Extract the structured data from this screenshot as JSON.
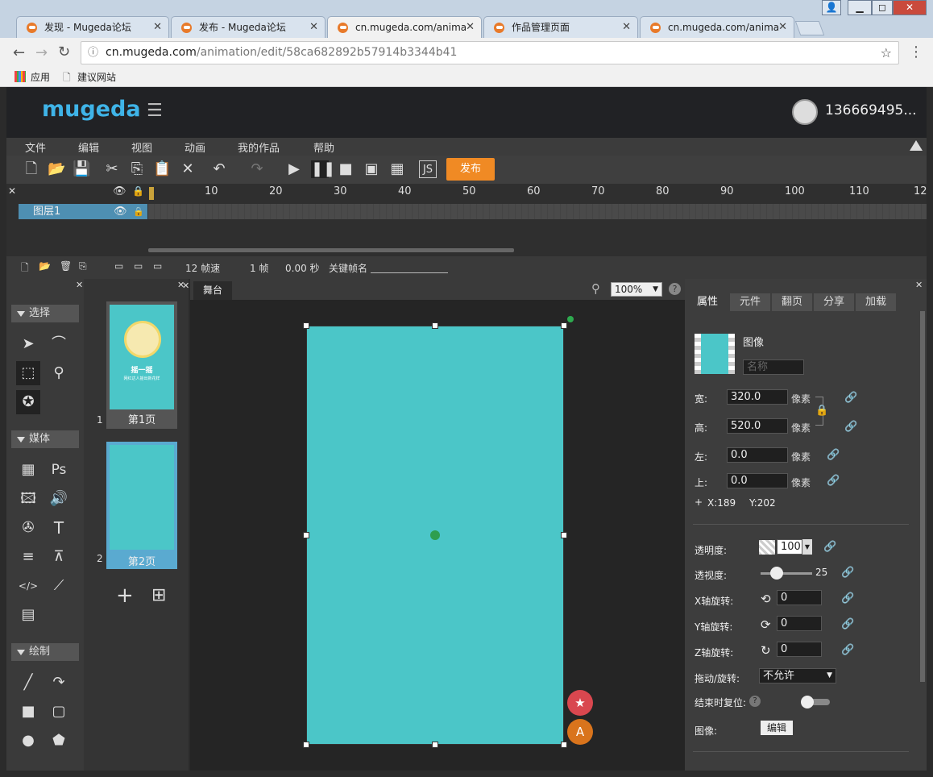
{
  "browser": {
    "tabs": [
      {
        "title": "发现 - Mugeda论坛"
      },
      {
        "title": "发布 - Mugeda论坛"
      },
      {
        "title": "cn.mugeda.com/anima"
      },
      {
        "title": "作品管理页面"
      },
      {
        "title": "cn.mugeda.com/anima"
      }
    ],
    "url_host": "cn.mugeda.com",
    "url_path": "/animation/edit/58ca682892b57914b3344b41",
    "bookmarks": [
      "应用",
      "建议网站"
    ]
  },
  "app": {
    "logo": "mugeda",
    "username": "136669495...",
    "menu": [
      "文件",
      "编辑",
      "视图",
      "动画",
      "我的作品",
      "帮助"
    ],
    "publish_label": "发布"
  },
  "timeline": {
    "ticks": [
      "10",
      "20",
      "30",
      "40",
      "50",
      "60",
      "70",
      "80",
      "90",
      "100",
      "110",
      "12"
    ],
    "layer_name": "图层1",
    "fps": "12 帧速",
    "frame": "1 帧",
    "time": "0.00 秒",
    "keyframe_label": "关键帧名"
  },
  "tools": {
    "sections": [
      "选择",
      "媒体",
      "绘制"
    ]
  },
  "pages": {
    "items": [
      {
        "num": "1",
        "label": "第1页",
        "thumb_title": "摇一摇",
        "thumb_sub": "网红达人摇出新花样"
      },
      {
        "num": "2",
        "label": "第2页"
      }
    ]
  },
  "stage": {
    "tab": "舞台",
    "zoom": "100%",
    "canvas_color": "#4bc6c8"
  },
  "props": {
    "tabs": [
      "属性",
      "元件",
      "翻页",
      "分享",
      "加载"
    ],
    "type_label": "图像",
    "name_placeholder": "名称",
    "width_label": "宽:",
    "width": "320.0",
    "height_label": "高:",
    "height": "520.0",
    "left_label": "左:",
    "left": "0.0",
    "top_label": "上:",
    "top": "0.0",
    "unit": "像素",
    "coords": "X:189",
    "coords_y": "Y:202",
    "opacity_label": "透明度:",
    "opacity": "100",
    "perspective_label": "透视度:",
    "perspective": "25",
    "perspective_fraction": 0.25,
    "rotx_label": "X轴旋转:",
    "rotx": "0",
    "roty_label": "Y轴旋转:",
    "roty": "0",
    "rotz_label": "Z轴旋转:",
    "rotz": "0",
    "drag_label": "拖动/旋转:",
    "drag_value": "不允许",
    "reset_label": "结束时复位:",
    "image_label": "图像:",
    "edit_button": "编辑"
  }
}
